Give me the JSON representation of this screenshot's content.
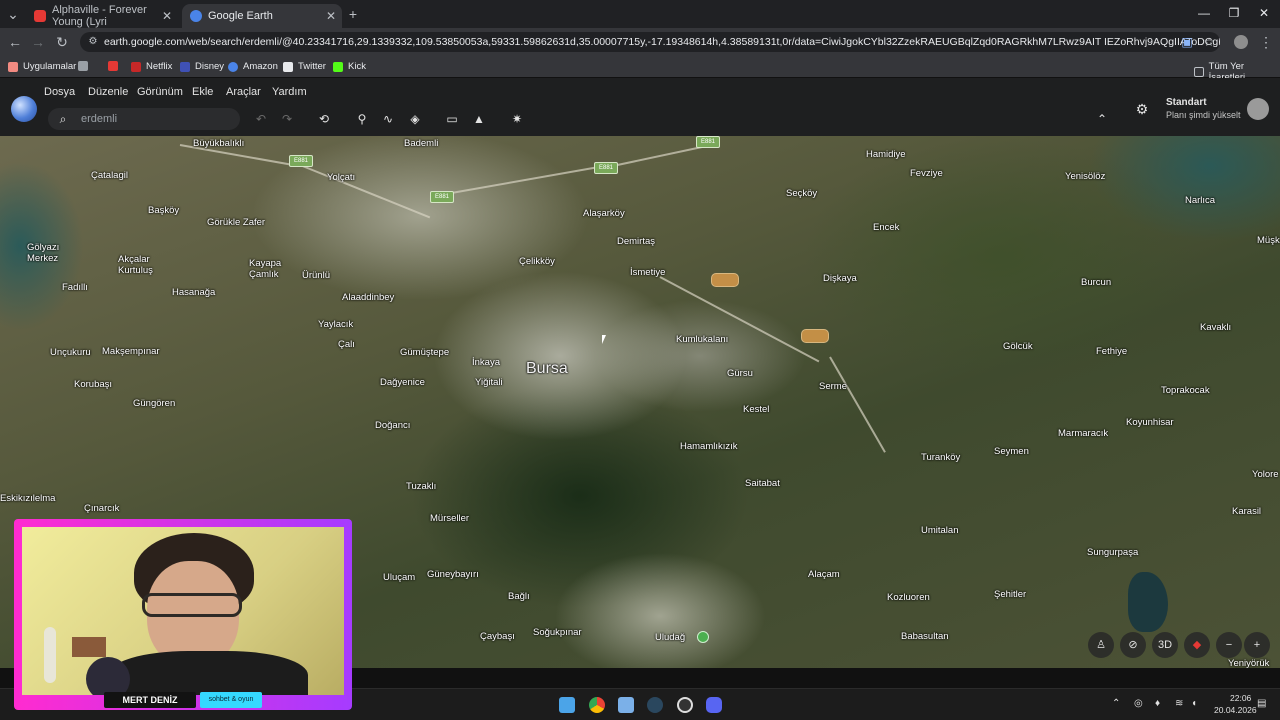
{
  "browser": {
    "tabs": [
      {
        "title": "Alphaville - Forever Young (Lyri",
        "active": false
      },
      {
        "title": "Google Earth",
        "active": true
      }
    ],
    "new_tab": "+",
    "url": "earth.google.com/web/search/erdemli/@40.23341716,29.1339332,109.53850053a,59331.59862631d,35.00007715y,-17.19348614h,4.38589131t,0r/data=CiwiJgokCYbl32ZzekRAEUGBqlZqd0RAGRkhM7LRwz9AIT IEZoRhvj9AQgIIAToDCgEwQgIIAEoNCP__________",
    "window_controls": {
      "minimize": "—",
      "maximize": "❐",
      "close": "✕"
    }
  },
  "bookmarks": [
    {
      "label": "Uygulamalar",
      "icon": "apps-grid-icon"
    },
    {
      "label": "",
      "icon": "youtube-icon"
    },
    {
      "label": "Netflix",
      "icon": "netflix-icon"
    },
    {
      "label": "Disney",
      "icon": "disney-icon"
    },
    {
      "label": "Amazon",
      "icon": "amazon-icon"
    },
    {
      "label": "Twitter",
      "icon": "x-icon"
    },
    {
      "label": "Kick",
      "icon": "kick-icon"
    },
    {
      "label": "Tüm Yer İşaretleri",
      "icon": "folder-icon"
    }
  ],
  "earth": {
    "menu": [
      "Dosya",
      "Düzenle",
      "Görünüm",
      "Ekle",
      "Araçlar",
      "Yardım"
    ],
    "search_value": "erdemli",
    "plan": {
      "title": "Standart",
      "subtitle": "Planı şimdi yükselt"
    },
    "view_3d": "3D"
  },
  "map": {
    "city": "Bursa",
    "labels": [
      "Büyükbalıklı",
      "Bademli",
      "Hamidiye",
      "Fevziye",
      "Yenisölöz",
      "Narlıca",
      "Müşk",
      "Çatalagil",
      "Yolçatı",
      "Seçköy",
      "Başköy",
      "Görükle Zafer",
      "Alaşarköy",
      "Encek",
      "Gölyazı Merkez",
      "Akçalar Kurtuluş",
      "Kayapa Çamlık",
      "Demirtaş",
      "Çelikköy",
      "İsmetiye",
      "Dişkaya",
      "Burcun",
      "Fadıllı",
      "Hasanağa",
      "Ürünlü",
      "Alaaddinbey",
      "Kavaklı",
      "Yaylacık",
      "Kumlukalanı",
      "Gölcük",
      "Fethiye",
      "Unçukuru",
      "Makşempınar",
      "Çalı",
      "Gümüştepe",
      "İnkaya",
      "Yiğitali",
      "Gürsu",
      "Serme",
      "Toprakocak",
      "Korubaşı",
      "Dağyenice",
      "Kestel",
      "Koyunhisar",
      "Güngören",
      "Doğancı",
      "Hamamlıkızık",
      "Marmaracık",
      "Seymen",
      "Turanköy",
      "Yolore",
      "Eskikızılelma",
      "Tuzaklı",
      "Saitabat",
      "Karasil",
      "Çınarcık",
      "Mürseller",
      "Umitalan",
      "Sungurpaşa",
      "Uluçam",
      "Güneybayırı",
      "Alaçam",
      "Bağlı",
      "Kozluoren",
      "Şehitler",
      "Çaybaşı",
      "Soğukpınar",
      "Uludağ",
      "Babasultan",
      "Yeniyörük"
    ],
    "road_shields": [
      "E881",
      "E881",
      "E881",
      "E881"
    ]
  },
  "stream": {
    "name": "MERT DENİZ",
    "tag": "sohbet & oyun"
  },
  "taskbar": {
    "time": "22:06",
    "date": "20.04.2026"
  }
}
